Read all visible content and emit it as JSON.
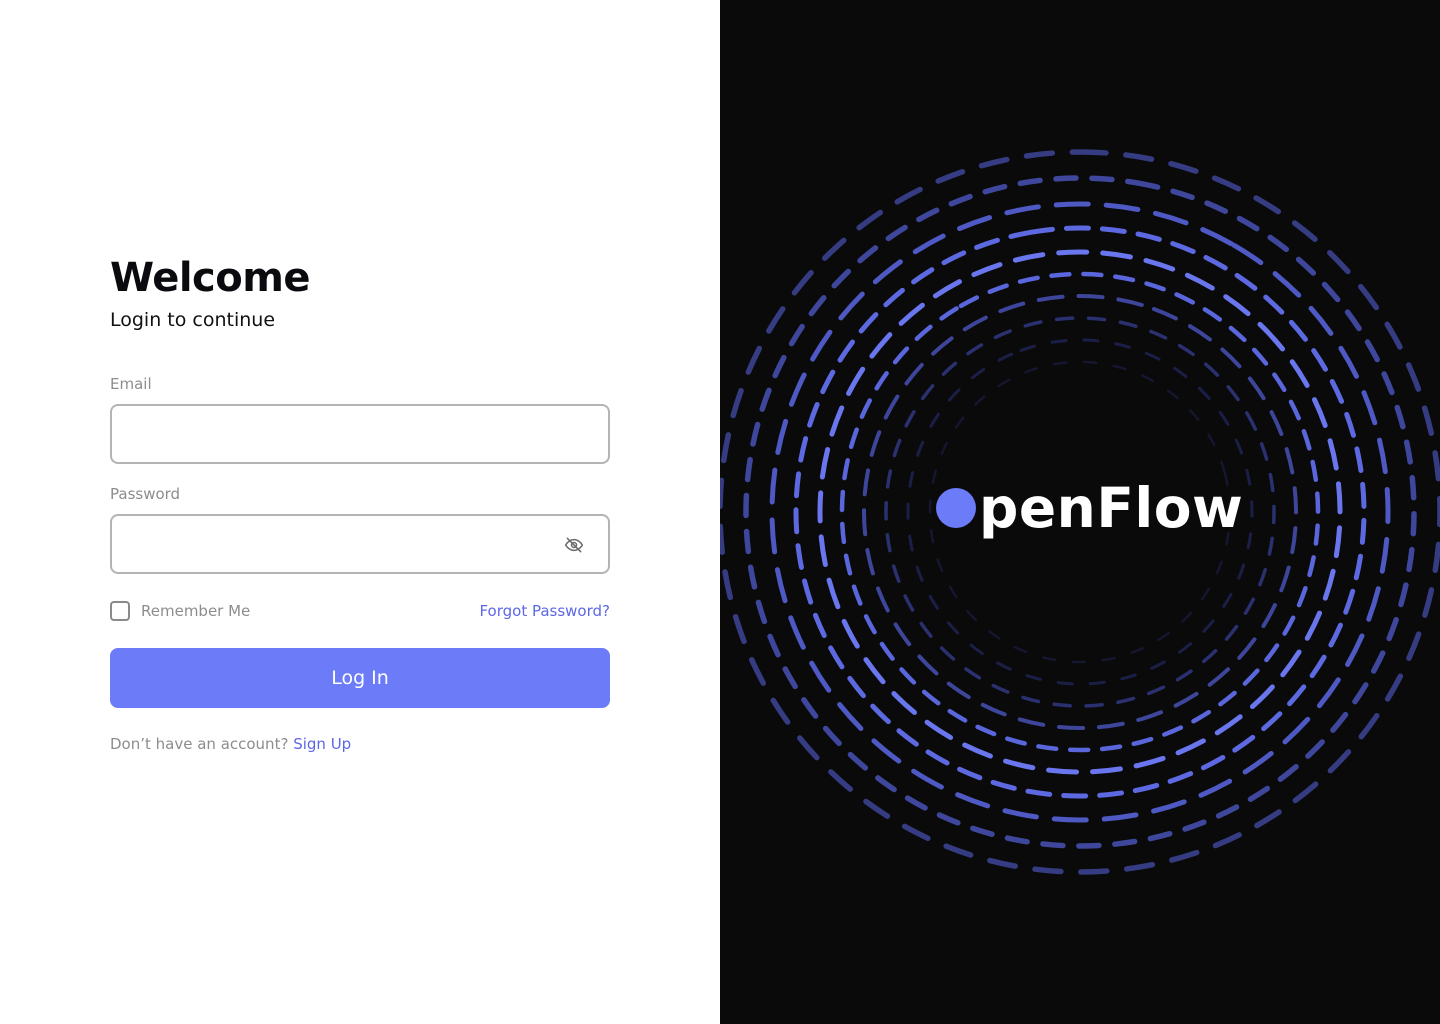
{
  "login": {
    "title": "Welcome",
    "subtitle": "Login to continue",
    "email_label": "Email",
    "email_value": "",
    "password_label": "Password",
    "password_value": "",
    "password_toggle_icon": "eye-off-icon",
    "remember_label": "Remember Me",
    "remember_checked": false,
    "forgot_label": "Forgot Password?",
    "login_button_label": "Log In",
    "signup_prompt": "Don’t have an account?",
    "signup_link": "Sign Up"
  },
  "brand": {
    "logo_text": "penFlow",
    "logo_mark_icon": "circle-dot-icon",
    "accent_color": "#6c7bf8",
    "link_color": "#5d67e6",
    "panel_background": "#0a0a0a"
  }
}
